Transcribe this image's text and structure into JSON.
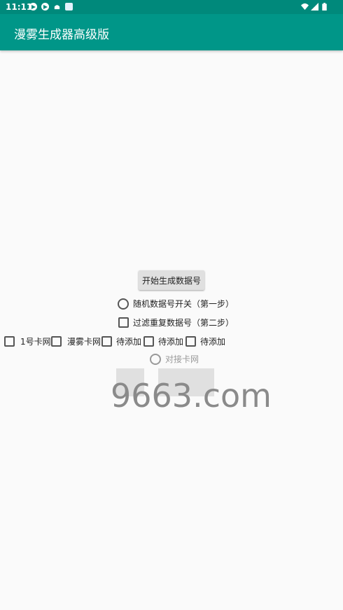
{
  "status_bar": {
    "time": "11:11",
    "left_icons": [
      "telegram-icon",
      "telegram-icon",
      "android-icon",
      "translate-icon"
    ],
    "right_icons": [
      "wifi-icon",
      "signal-icon",
      "battery-icon"
    ]
  },
  "app_bar": {
    "title": "漫雾生成器高级版",
    "color": "#009688"
  },
  "main": {
    "generate_button": "开始生成数据号",
    "random_toggle": "随机数据号开关（第一步）",
    "filter_duplicates": "过滤重复数据号（第二步）",
    "sources": [
      {
        "label": "1号卡网"
      },
      {
        "label": "漫雾卡网"
      },
      {
        "label": "待添加"
      },
      {
        "label": "待添加"
      },
      {
        "label": "待添加"
      }
    ],
    "connect_radio": "对接卡网"
  },
  "watermark": "9663.com"
}
